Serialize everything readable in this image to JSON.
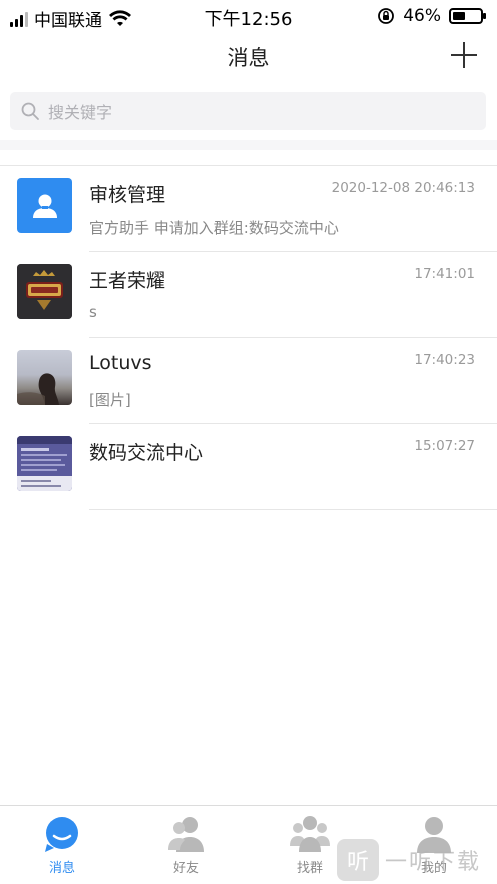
{
  "status_bar": {
    "carrier": "中国联通",
    "time": "下午12:56",
    "battery": "46%",
    "battery_level": 0.46
  },
  "header": {
    "title": "消息",
    "add_icon": "plus-icon"
  },
  "search": {
    "placeholder": "搜关键字",
    "icon": "search-icon"
  },
  "conversations": [
    {
      "name": "审核管理",
      "time": "2020-12-08 20:46:13",
      "preview": "官方助手 申请加入群组:数码交流中心",
      "avatar": "person-icon",
      "avatar_color": "#2f8cf0"
    },
    {
      "name": "王者荣耀",
      "time": "17:41:01",
      "preview": "s",
      "avatar": "game-logo"
    },
    {
      "name": "Lotuvs",
      "time": "17:40:23",
      "preview": "[图片]",
      "avatar": "photo-avatar"
    },
    {
      "name": "数码交流中心",
      "time": "15:07:27",
      "preview": "",
      "avatar": "group-avatar"
    }
  ],
  "tabs": [
    {
      "label": "消息",
      "icon": "message-icon",
      "active": true
    },
    {
      "label": "好友",
      "icon": "friends-icon",
      "active": false
    },
    {
      "label": "找群",
      "icon": "group-search-icon",
      "active": false
    },
    {
      "label": "我的",
      "icon": "profile-icon",
      "active": false
    }
  ],
  "watermark": {
    "badge": "听",
    "text": "一听下载"
  },
  "colors": {
    "accent": "#2f8cf0",
    "inactive": "#b8b8b8"
  }
}
